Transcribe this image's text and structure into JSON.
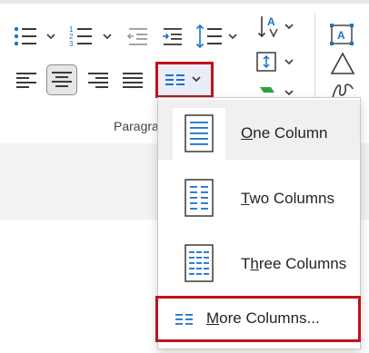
{
  "ribbon": {
    "group_label": "Paragra",
    "buttons": {
      "bullets": "bullets-icon",
      "numbering": "numbering-icon",
      "decrease_indent": "decrease-indent-icon",
      "increase_indent": "increase-indent-icon",
      "line_spacing": "line-spacing-icon",
      "sort": "sort-icon",
      "align_left": "align-left-icon",
      "align_center": "align-center-icon",
      "align_right": "align-right-icon",
      "justify": "justify-icon",
      "columns": "columns-icon"
    }
  },
  "menu": {
    "items": [
      {
        "pre": "",
        "key": "O",
        "post": "ne Column",
        "icon": "one-column-icon"
      },
      {
        "pre": "",
        "key": "T",
        "post": "wo Columns",
        "icon": "two-columns-icon"
      },
      {
        "pre": "T",
        "key": "h",
        "post": "ree Columns",
        "icon": "three-columns-icon"
      }
    ],
    "more": {
      "pre": "",
      "key": "M",
      "post": "ore Columns...",
      "icon": "more-columns-icon"
    }
  },
  "colors": {
    "accent_blue": "#1a73c9",
    "highlight_red": "#c1121f",
    "icon_dark": "#3b3a39"
  }
}
